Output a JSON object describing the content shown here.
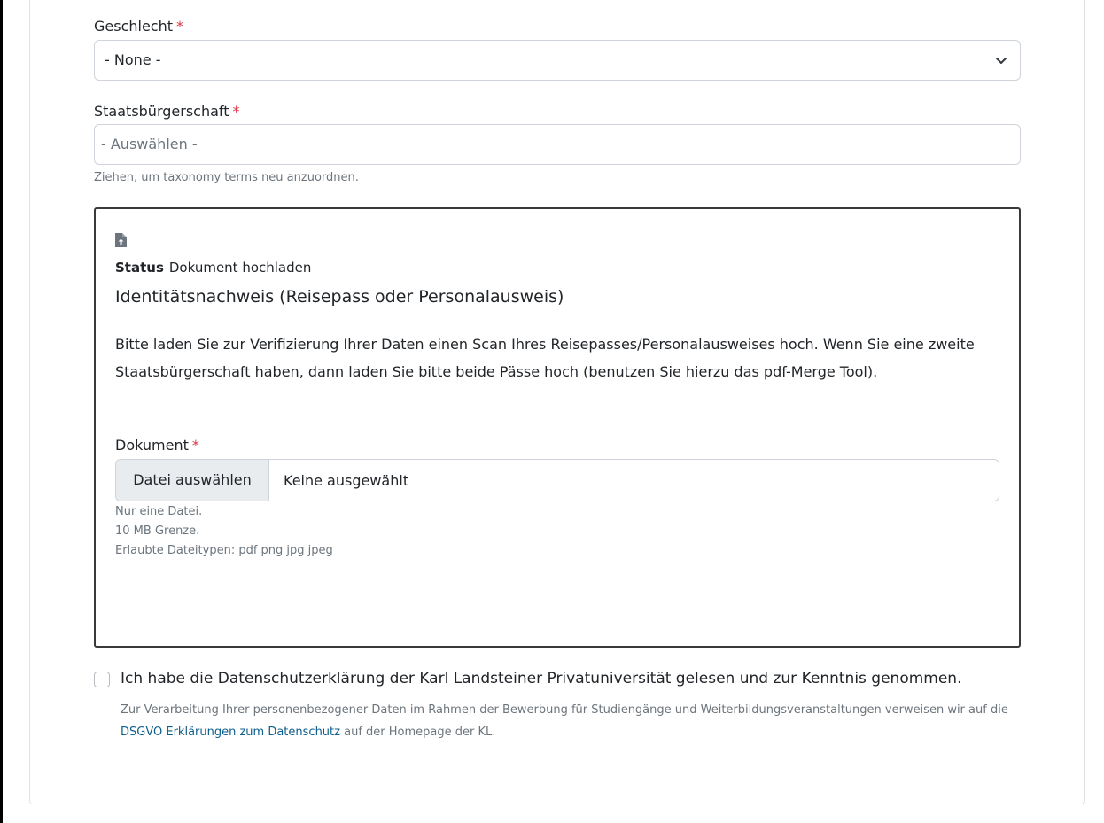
{
  "gender": {
    "label": "Geschlecht",
    "required_mark": "*",
    "selected_value": "- None -"
  },
  "citizenship": {
    "label": "Staatsbürgerschaft",
    "required_mark": "*",
    "placeholder": "- Auswählen -",
    "help": "Ziehen, um taxonomy terms neu anzuordnen."
  },
  "document_box": {
    "icon": "file-upload-icon",
    "status_label": "Status",
    "status_value": "Dokument hochladen",
    "title": "Identitätsnachweis (Reisepass oder Personalausweis)",
    "description": "Bitte laden Sie zur Verifizierung Ihrer Daten einen Scan Ihres Reisepasses/Personalausweises hoch. Wenn Sie eine zweite Staatsbürgerschaft haben, dann laden Sie bitte beide Pässe hoch (benutzen Sie hierzu das pdf-Merge Tool).",
    "field_label": "Dokument",
    "required_mark": "*",
    "file_button": "Datei auswählen",
    "file_status": "Keine ausgewählt",
    "help_lines": [
      "Nur eine Datei.",
      "10 MB Grenze.",
      "Erlaubte Dateitypen: pdf png jpg jpeg"
    ]
  },
  "consent": {
    "checked": false,
    "label": "Ich habe die Datenschutzerklärung der Karl Landsteiner Privatuniversität gelesen und zur Kenntnis genommen.",
    "help_before": "Zur Verarbeitung Ihrer personenbezogener Daten im Rahmen der Bewerbung für Studiengänge und Weiterbildungsveranstaltungen verweisen wir auf die",
    "help_link": "DSGVO Erklärungen zum Datenschutz",
    "help_after": "auf der Homepage der KL."
  },
  "colors": {
    "required": "#dc3545",
    "link": "#0d5e8c",
    "help_text": "#6c757d",
    "border": "#ced4da"
  }
}
